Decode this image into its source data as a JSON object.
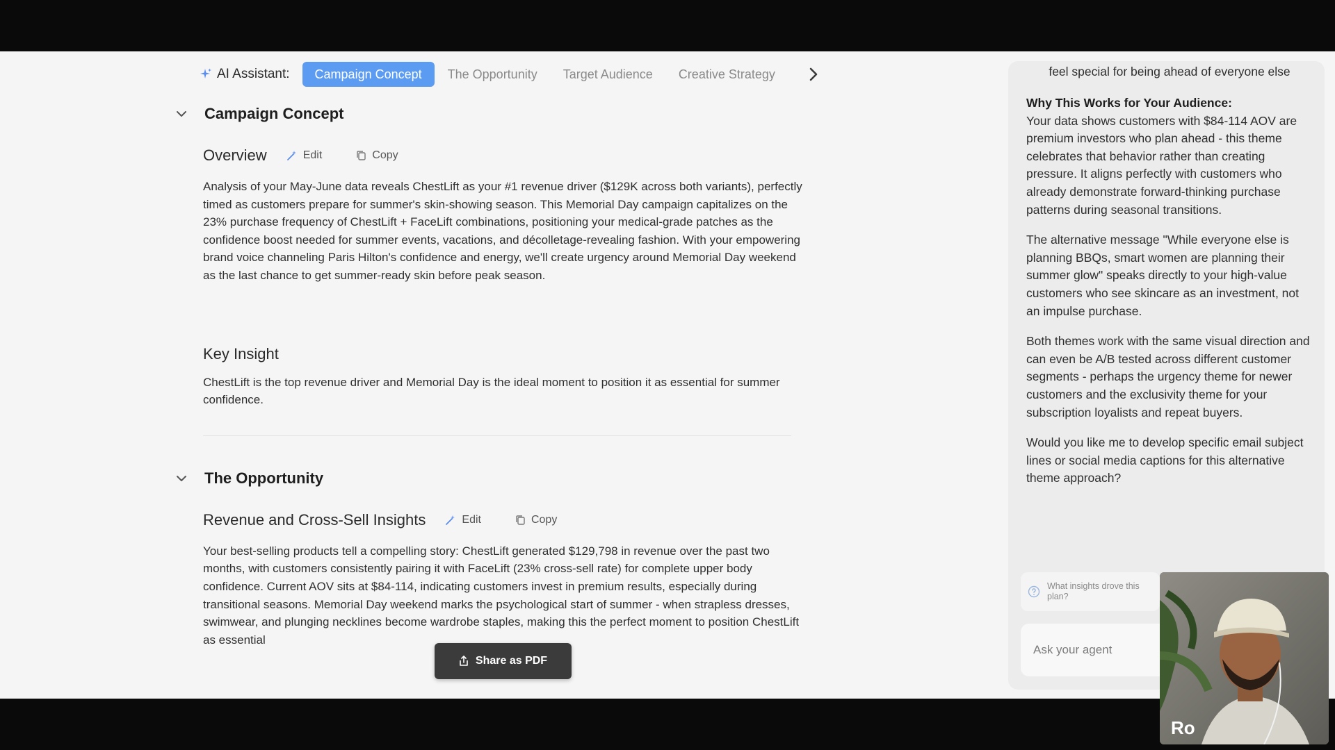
{
  "tabs": {
    "assistant_label": "AI Assistant:",
    "items": [
      {
        "label": "Campaign Concept",
        "active": true
      },
      {
        "label": "The Opportunity",
        "active": false
      },
      {
        "label": "Target Audience",
        "active": false
      },
      {
        "label": "Creative Strategy",
        "active": false
      }
    ],
    "next_icon": "chevron-right-icon"
  },
  "sections": {
    "campaign": {
      "title": "Campaign Concept",
      "overview": {
        "title": "Overview",
        "edit": "Edit",
        "copy": "Copy",
        "text": "Analysis of your May-June data reveals ChestLift as your #1 revenue driver ($129K across both variants), perfectly timed as customers prepare for summer's skin-showing season. This Memorial Day campaign capitalizes on the 23% purchase frequency of ChestLift + FaceLift combinations, positioning your medical-grade patches as the confidence boost needed for summer events, vacations, and décolletage-revealing fashion. With your empowering brand voice channeling Paris Hilton's confidence and energy, we'll create urgency around Memorial Day weekend as the last chance to get summer-ready skin before peak season."
      },
      "key_insight": {
        "title": "Key Insight",
        "text": "ChestLift is the top revenue driver and Memorial Day is the ideal moment to position it as essential for summer confidence."
      }
    },
    "opportunity": {
      "title": "The Opportunity",
      "revenue": {
        "title": "Revenue and Cross-Sell Insights",
        "edit": "Edit",
        "copy": "Copy",
        "text": "Your best-selling products tell a compelling story: ChestLift generated $129,798 in revenue over the past two months, with customers consistently pairing it with FaceLift (23% cross-sell rate) for complete upper body confidence. Current AOV sits at $84-114, indicating customers invest in premium results, especially during transitional seasons. Memorial Day weekend marks the psychological start of summer - when strapless dresses, swimwear, and plunging necklines become wardrobe staples, making this the perfect moment to position ChestLift as essential"
      }
    }
  },
  "share_button": "Share as PDF",
  "chat": {
    "top_line": "feel special for being ahead of everyone else",
    "why_heading": "Why This Works for Your Audience:",
    "why_text": "Your data shows customers with $84-114 AOV are premium investors who plan ahead - this theme celebrates that behavior rather than creating pressure. It aligns perfectly with customers who already demonstrate forward-thinking purchase patterns during seasonal transitions.",
    "alt_text": "The alternative message \"While everyone else is planning BBQs, smart women are planning their summer glow\" speaks directly to your high-value customers who see skincare as an investment, not an impulse purchase.",
    "both_text": "Both themes work with the same visual direction and can even be A/B tested across different customer segments - perhaps the urgency theme for newer customers and the exclusivity theme for your subscription loyalists and repeat buyers.",
    "question_text": "Would you like me to develop specific email subject lines or social media captions for this alternative theme approach?",
    "suggestion": "What insights drove this plan?",
    "input_placeholder": "Ask your agent"
  },
  "video": {
    "name": "Ro"
  }
}
